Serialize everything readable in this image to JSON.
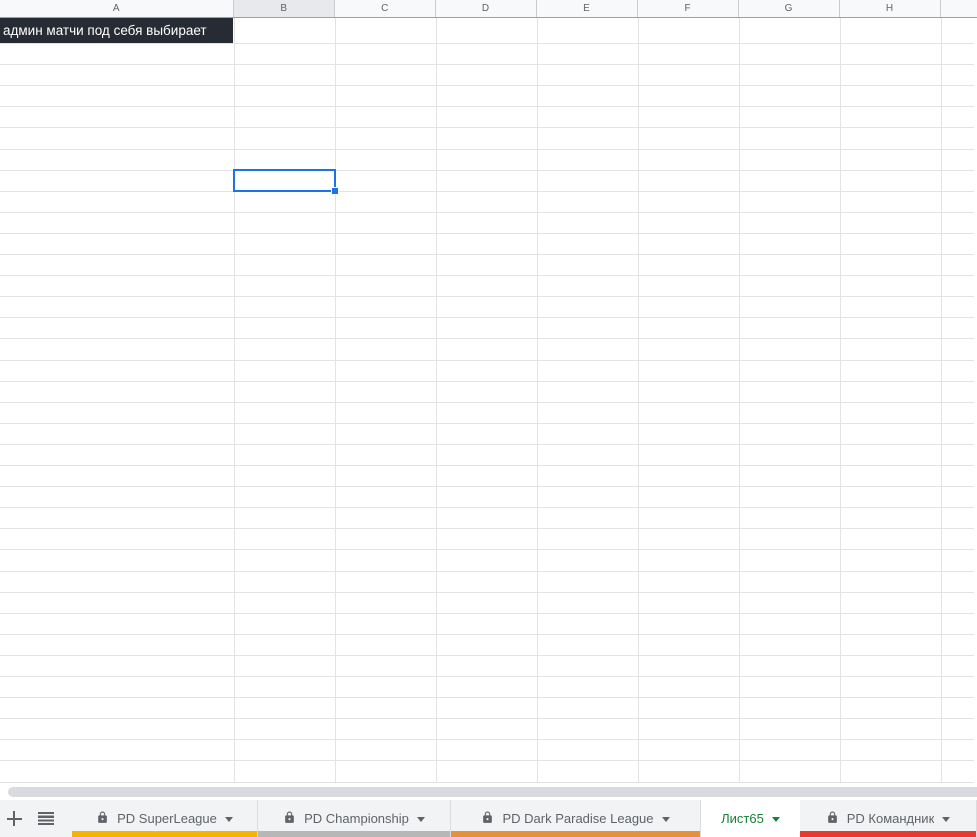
{
  "sheet": {
    "columns": [
      "A",
      "B",
      "C",
      "D",
      "E",
      "F",
      "G",
      "H"
    ],
    "selected_column": "B",
    "selected_cell": "B8",
    "cell_a1_text": "админ матчи под себя выбирает",
    "colors": {
      "a1_background": "#272c34",
      "a1_text": "#ffffff",
      "selection": "#1a73e8"
    }
  },
  "tabbar": {
    "active_text_color": "#188038",
    "inactive_text_color": "#5f6368",
    "tabs": [
      {
        "label": "PD SuperLeague",
        "locked": true,
        "active": false,
        "color": "#f5b400"
      },
      {
        "label": "PD Championship",
        "locked": true,
        "active": false,
        "color": "#b7b7b7"
      },
      {
        "label": "PD Dark Paradise League",
        "locked": true,
        "active": false,
        "color": "#e6913a"
      },
      {
        "label": "Лист65",
        "locked": false,
        "active": true,
        "color": null
      },
      {
        "label": "PD Командник",
        "locked": true,
        "active": false,
        "color": "#e8392e"
      }
    ]
  }
}
